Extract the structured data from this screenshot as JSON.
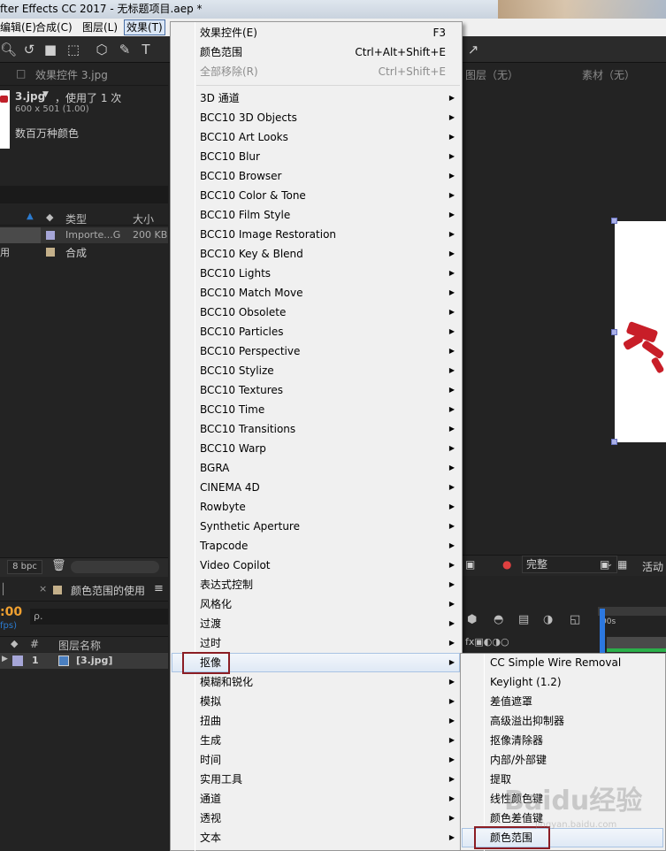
{
  "window": {
    "title": "fter Effects CC 2017 - 无标题项目.aep *"
  },
  "menubar": {
    "items": [
      "编辑(E)",
      "合成(C)",
      "图层(L)",
      "效果(T)"
    ]
  },
  "project": {
    "tab_title": "效果控件 3.jpg",
    "file_name": "3.jpg",
    "file_usage": "，使用了 1 次",
    "file_dims": "600 x 501 (1.00)",
    "file_colors": "数百万种颜色",
    "columns": {
      "type": "类型",
      "size": "大小"
    },
    "rows": [
      {
        "name": "",
        "type": "Importe...G",
        "size": "200 KB",
        "swatch": "#a6a6d8"
      },
      {
        "name": "用",
        "type": "合成",
        "size": "",
        "swatch": "#c4b08a"
      }
    ],
    "bpc": "8 bpc"
  },
  "viewer": {
    "tab_layer": "图层（无）",
    "tab_footage": "素材（无）",
    "quality": "完整",
    "active": "活动"
  },
  "timeline": {
    "tab_title": "颜色范围的使用",
    "timecode": ":00",
    "fps": "fps)",
    "search_placeholder": "ρ.",
    "col_num": "#",
    "col_layer_name": "图层名称",
    "layer_index": "1",
    "layer_name": "[3.jpg]",
    "ruler_label": "00s"
  },
  "effect_menu": {
    "top_items": [
      {
        "label": "效果控件(E)",
        "shortcut": "F3",
        "disabled": false
      },
      {
        "label": "颜色范围",
        "shortcut": "Ctrl+Alt+Shift+E",
        "disabled": false
      },
      {
        "label": "全部移除(R)",
        "shortcut": "Ctrl+Shift+E",
        "disabled": true
      }
    ],
    "categories": [
      "3D 通道",
      "BCC10 3D Objects",
      "BCC10 Art Looks",
      "BCC10 Blur",
      "BCC10 Browser",
      "BCC10 Color & Tone",
      "BCC10 Film Style",
      "BCC10 Image Restoration",
      "BCC10 Key & Blend",
      "BCC10 Lights",
      "BCC10 Match Move",
      "BCC10 Obsolete",
      "BCC10 Particles",
      "BCC10 Perspective",
      "BCC10 Stylize",
      "BCC10 Textures",
      "BCC10 Time",
      "BCC10 Transitions",
      "BCC10 Warp",
      "BGRA",
      "CINEMA 4D",
      "Rowbyte",
      "Synthetic Aperture",
      "Trapcode",
      "Video Copilot",
      "表达式控制",
      "风格化",
      "过渡",
      "过时",
      "抠像",
      "模糊和锐化",
      "模拟",
      "扭曲",
      "生成",
      "时间",
      "实用工具",
      "通道",
      "透视",
      "文本"
    ],
    "highlighted": "抠像"
  },
  "keying_submenu": {
    "items": [
      "CC Simple Wire Removal",
      "Keylight (1.2)",
      "差值遮罩",
      "高级溢出抑制器",
      "抠像清除器",
      "内部/外部键",
      "提取",
      "线性颜色键",
      "颜色差值键",
      "颜色范围"
    ],
    "highlighted": "颜色范围"
  },
  "watermark": {
    "text": "Baidu经验",
    "sub": "jingyan.baidu.com"
  },
  "colors": {
    "highlight_box": "#8b1d24",
    "menu_bg": "#f0f0f0",
    "panel_bg": "#232323",
    "timecode": "#f0a030"
  }
}
